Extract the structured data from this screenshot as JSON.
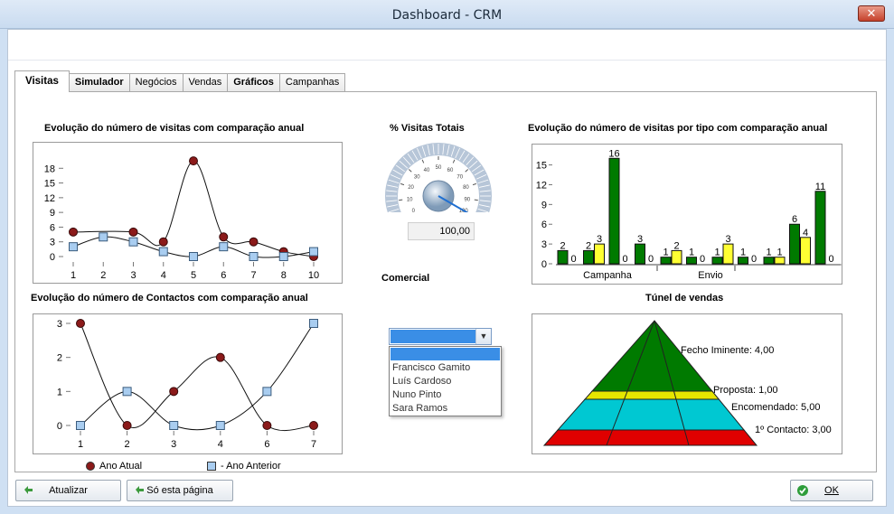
{
  "window": {
    "title": "Dashboard - CRM",
    "close_label": "✕"
  },
  "tabs": [
    {
      "label": "Visitas",
      "active": true
    },
    {
      "label": "Simulador",
      "bold": true
    },
    {
      "label": "Negócios"
    },
    {
      "label": "Vendas"
    },
    {
      "label": "Gráficos",
      "bold": true
    },
    {
      "label": "Campanhas"
    }
  ],
  "titles": {
    "visits_line": "Evolução do número de visitas com comparação anual",
    "gauge": "% Visitas Totais",
    "visits_bar": "Evolução do número de visitas por tipo com comparação anual",
    "contacts_line": "Evolução do número de Contactos com comparação anual",
    "comercial": "Comercial",
    "funnel": "Túnel de vendas"
  },
  "gauge": {
    "value_text": "100,00",
    "value": 100,
    "ticks": [
      "0",
      "10",
      "20",
      "30",
      "40",
      "50",
      "60",
      "70",
      "80",
      "90",
      "100"
    ]
  },
  "comercial": {
    "selected": "",
    "options": [
      "Francisco Gamito",
      "Luís Cardoso",
      "Nuno Pinto",
      "Sara Ramos"
    ]
  },
  "legend": {
    "current": "Ano Atual",
    "previous": "- Ano Anterior"
  },
  "colors": {
    "current": "#8b1a1a",
    "previous": "#a9cdf0",
    "bar_current": "#007a00",
    "bar_previous": "#ffff33"
  },
  "buttons": {
    "refresh": "Atualizar",
    "this_page": "Só esta página",
    "ok": "OK"
  },
  "chart_data": [
    {
      "type": "line",
      "name": "visits_line",
      "x": [
        "1",
        "2",
        "3",
        "4",
        "5",
        "6",
        "7",
        "8",
        "10"
      ],
      "ylim": [
        0,
        21
      ],
      "yticks": [
        "0",
        "3",
        "6",
        "9",
        "12",
        "15",
        "18"
      ],
      "series": [
        {
          "name": "Ano Atual",
          "values": [
            5,
            null,
            5,
            3,
            19.5,
            4,
            3,
            1,
            0
          ]
        },
        {
          "name": "Ano Anterior",
          "values": [
            2,
            4,
            3,
            1,
            0,
            2,
            0,
            0,
            1
          ]
        }
      ]
    },
    {
      "type": "line",
      "name": "contacts_line",
      "x": [
        "1",
        "2",
        "3",
        "4",
        "6",
        "7"
      ],
      "ylim": [
        0,
        3
      ],
      "yticks": [
        "0",
        "1",
        "2",
        "3"
      ],
      "series": [
        {
          "name": "Ano Atual",
          "values": [
            3,
            0,
            1,
            2,
            0,
            0
          ]
        },
        {
          "name": "Ano Anterior",
          "values": [
            0,
            1,
            0,
            0,
            1,
            3
          ]
        }
      ]
    },
    {
      "type": "bar",
      "name": "visits_bar",
      "ylim": [
        0,
        17
      ],
      "yticks": [
        "0",
        "3",
        "6",
        "9",
        "12",
        "15"
      ],
      "group_labels": [
        "Campanha",
        "Envio"
      ],
      "pairs": [
        [
          2,
          0
        ],
        [
          2,
          3
        ],
        [
          16,
          0
        ],
        [
          3,
          0
        ],
        [
          1,
          2
        ],
        [
          1,
          0
        ],
        [
          1,
          3
        ],
        [
          1,
          0
        ],
        [
          1,
          1
        ],
        [
          6,
          4
        ],
        [
          11,
          0
        ]
      ],
      "series": [
        {
          "name": "Ano Atual",
          "values": [
            2,
            2,
            16,
            3,
            1,
            1,
            1,
            1,
            1,
            6,
            11
          ]
        },
        {
          "name": "Ano Anterior",
          "values": [
            0,
            3,
            0,
            0,
            2,
            0,
            3,
            0,
            1,
            4,
            0
          ]
        }
      ]
    },
    {
      "type": "funnel",
      "name": "funnel",
      "stages": [
        {
          "label": "Fecho Iminente: 4,00",
          "value": 4,
          "color": "#007a00"
        },
        {
          "label": "Proposta: 1,00",
          "value": 1,
          "color": "#e6e600"
        },
        {
          "label": "Encomendado: 5,00",
          "value": 5,
          "color": "#00c8d2"
        },
        {
          "label": "1º Contacto: 3,00",
          "value": 3,
          "color": "#e00000"
        }
      ]
    }
  ]
}
